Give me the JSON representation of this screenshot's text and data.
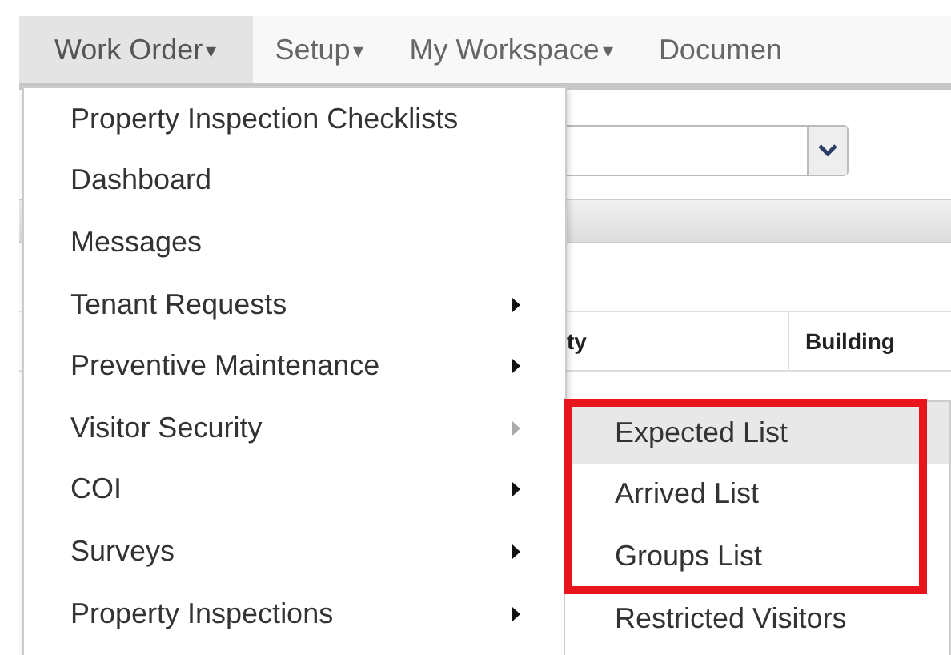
{
  "navbar": {
    "items": [
      {
        "label": "Work Order",
        "caret": "▾",
        "selected": true
      },
      {
        "label": "Setup",
        "caret": "▾",
        "selected": false
      },
      {
        "label": "My Workspace",
        "caret": "▾",
        "selected": false
      },
      {
        "label": "Documen",
        "selected": false
      }
    ]
  },
  "table": {
    "columns": [
      "ty",
      "Building"
    ]
  },
  "menu": {
    "items": [
      {
        "label": "Property Inspection Checklists",
        "submenu": false,
        "expanded": false
      },
      {
        "label": "Dashboard",
        "submenu": false,
        "expanded": false
      },
      {
        "label": "Messages",
        "submenu": false,
        "expanded": false
      },
      {
        "label": "Tenant Requests",
        "submenu": true,
        "expanded": false
      },
      {
        "label": "Preventive Maintenance",
        "submenu": true,
        "expanded": false
      },
      {
        "label": "Visitor Security",
        "submenu": true,
        "expanded": true
      },
      {
        "label": "COI",
        "submenu": true,
        "expanded": false
      },
      {
        "label": "Surveys",
        "submenu": true,
        "expanded": false
      },
      {
        "label": "Property Inspections",
        "submenu": true,
        "expanded": false
      }
    ]
  },
  "submenu": {
    "items": [
      {
        "label": "Expected List",
        "selected": true
      },
      {
        "label": "Arrived List",
        "selected": false
      },
      {
        "label": "Groups List",
        "selected": false
      },
      {
        "label": "Restricted Visitors",
        "selected": false
      }
    ]
  }
}
